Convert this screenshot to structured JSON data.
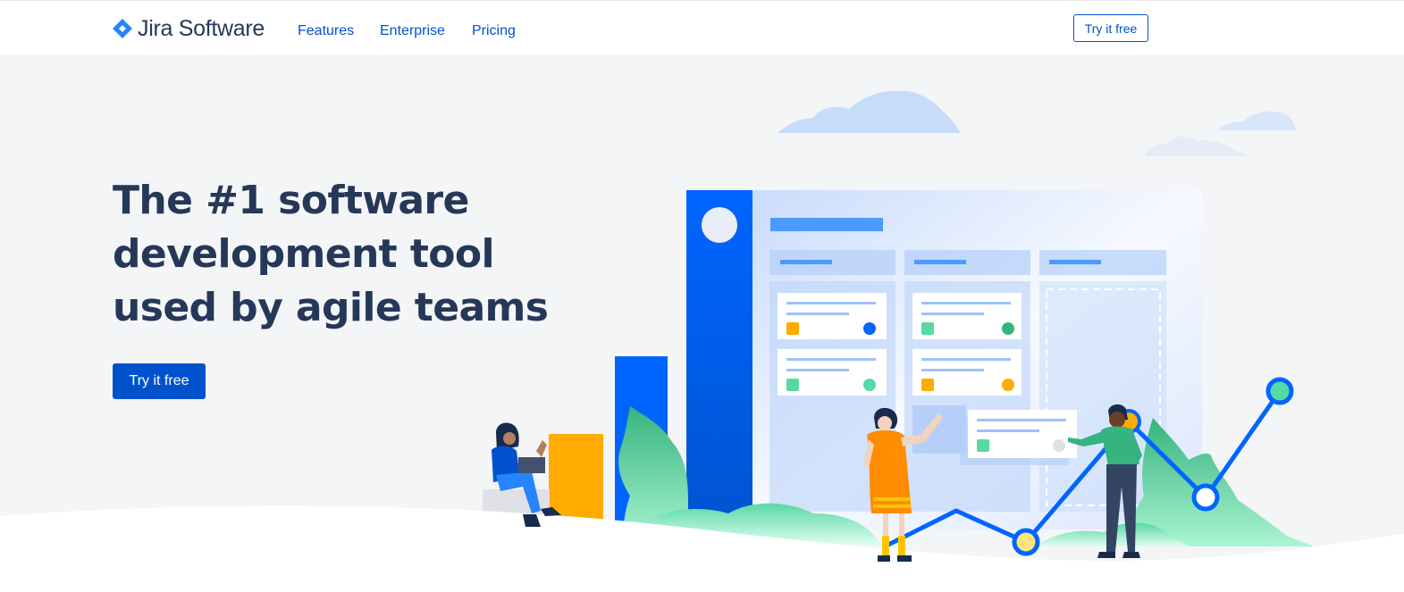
{
  "brand": {
    "name": "Jira Software",
    "logo_icon": "jira-diamond-icon",
    "logo_color": "#2684FF"
  },
  "nav": {
    "items": [
      {
        "label": "Features"
      },
      {
        "label": "Enterprise"
      },
      {
        "label": "Pricing"
      }
    ],
    "cta_label": "Try it free"
  },
  "hero": {
    "title_lines": [
      "The #1 software",
      "development tool",
      "used by agile teams"
    ],
    "cta_label": "Try it free"
  },
  "colors": {
    "primary": "#0052CC",
    "heading": "#253858",
    "hero_background": "#F4F5F7",
    "accent_blue": "#0065FF",
    "accent_yellow": "#FFAB00",
    "accent_green": "#57D9A3"
  }
}
